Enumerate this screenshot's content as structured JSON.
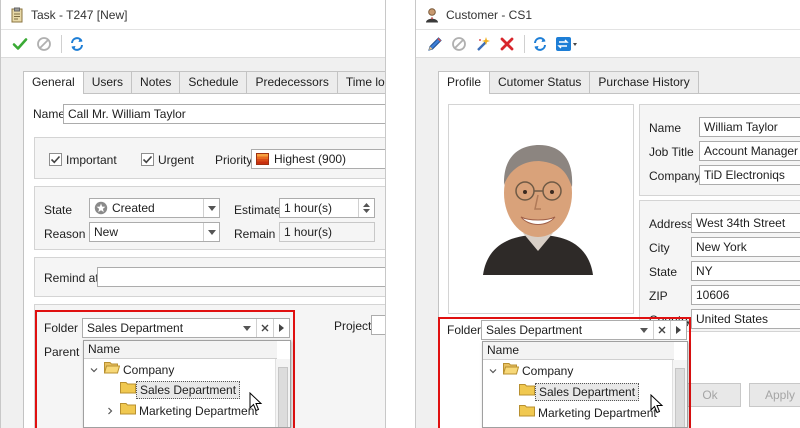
{
  "task_window": {
    "title": "Task - T247 [New]",
    "toolbar": {
      "icons": [
        "save-check-icon",
        "cancel-icon",
        "refresh-icon"
      ]
    },
    "tabs": [
      "General",
      "Users",
      "Notes",
      "Schedule",
      "Predecessors",
      "Time log"
    ],
    "name": {
      "label": "Name",
      "value": "Call Mr. William Taylor"
    },
    "important": {
      "label": "Important",
      "checked": true
    },
    "urgent": {
      "label": "Urgent",
      "checked": true
    },
    "priority": {
      "label": "Priority",
      "value": "Highest (900)"
    },
    "state": {
      "label": "State",
      "value": "Created"
    },
    "reason": {
      "label": "Reason",
      "value": "New"
    },
    "estimate": {
      "label": "Estimate",
      "value": "1 hour(s)"
    },
    "remain": {
      "label": "Remain",
      "value": "1 hour(s)"
    },
    "remind_at": {
      "label": "Remind at",
      "value": ""
    },
    "folder": {
      "label": "Folder",
      "value": "Sales Department"
    },
    "project": {
      "label": "Project",
      "value": ""
    },
    "parent": {
      "label": "Parent"
    },
    "popup": {
      "header": "Name",
      "items": [
        "Company",
        "Sales Department",
        "Marketing Department"
      ]
    }
  },
  "customer_window": {
    "title": "Customer - CS1",
    "toolbar": {
      "icons": [
        "edit-pencil-icon",
        "cancel-icon",
        "magic-wand-icon",
        "delete-icon",
        "refresh-icon",
        "transfer-icon"
      ]
    },
    "tabs": [
      "Profile",
      "Cutomer Status",
      "Purchase History"
    ],
    "name": {
      "label": "Name",
      "value": "William Taylor"
    },
    "job_title": {
      "label": "Job Title",
      "value": "Account Manager"
    },
    "company": {
      "label": "Company",
      "value": "TiD Electroniqs"
    },
    "address": {
      "label": "Address",
      "value": "West 34th Street"
    },
    "city": {
      "label": "City",
      "value": "New York"
    },
    "state": {
      "label": "State",
      "value": "NY"
    },
    "zip": {
      "label": "ZIP",
      "value": "10606"
    },
    "country": {
      "label": "Country",
      "value": "United States"
    },
    "folder": {
      "label": "Folder",
      "value": "Sales Department"
    },
    "popup": {
      "header": "Name",
      "items": [
        "Company",
        "Sales Department",
        "Marketing Department"
      ]
    },
    "buttons": {
      "ok": "Ok",
      "apply": "Apply"
    }
  },
  "colors": {
    "highlight": "#e01010",
    "folder": "#f0c040",
    "check_green": "#3aaa35"
  }
}
